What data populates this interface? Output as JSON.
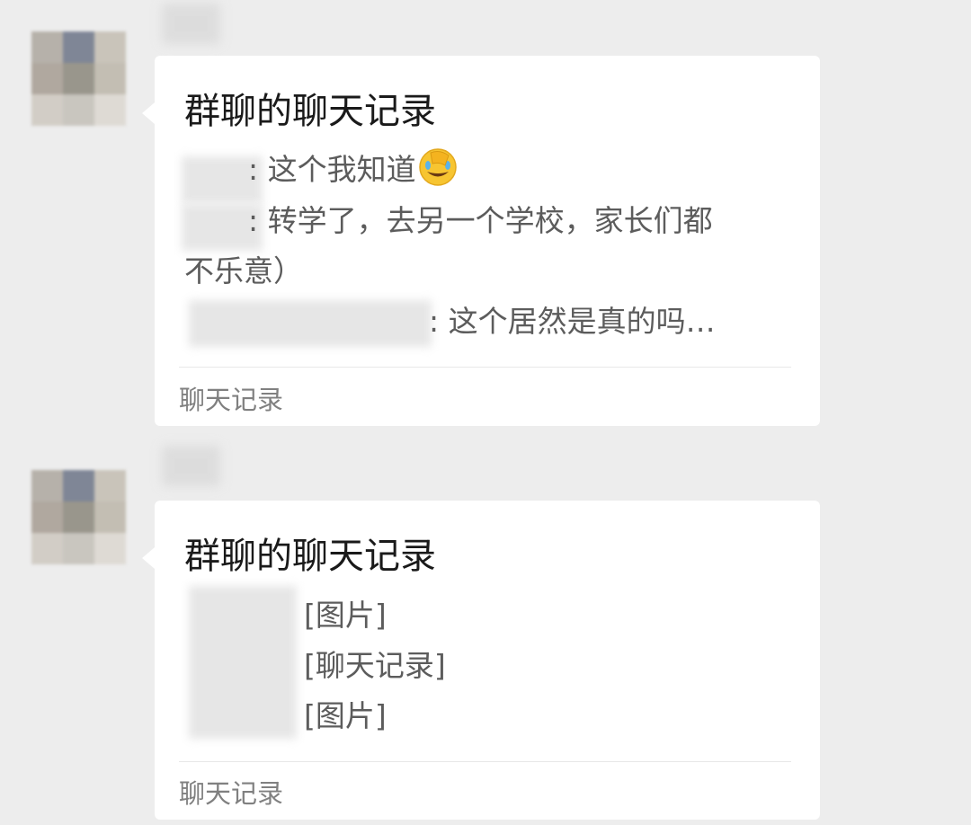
{
  "messages": [
    {
      "card_title": "群聊的聊天记录",
      "lines": [
        {
          "text": ": 这个我知道",
          "emoji": "facepalm-laughing-emoji"
        },
        {
          "text": ": 转学了，去另一个学校，家长们都"
        },
        {
          "text": "不乐意）"
        },
        {
          "text": ": 这个居然是真的吗…"
        }
      ],
      "footer": "聊天记录"
    },
    {
      "card_title": "群聊的聊天记录",
      "lines": [
        {
          "text": "[图片]"
        },
        {
          "text": "[聊天记录]"
        },
        {
          "text": "[图片]"
        }
      ],
      "footer": "聊天记录"
    }
  ],
  "colors": {
    "background": "#ededed",
    "bubble": "#ffffff",
    "title_text": "#1a1a1a",
    "body_text": "#5c5c5c",
    "footer_text": "#808080"
  }
}
